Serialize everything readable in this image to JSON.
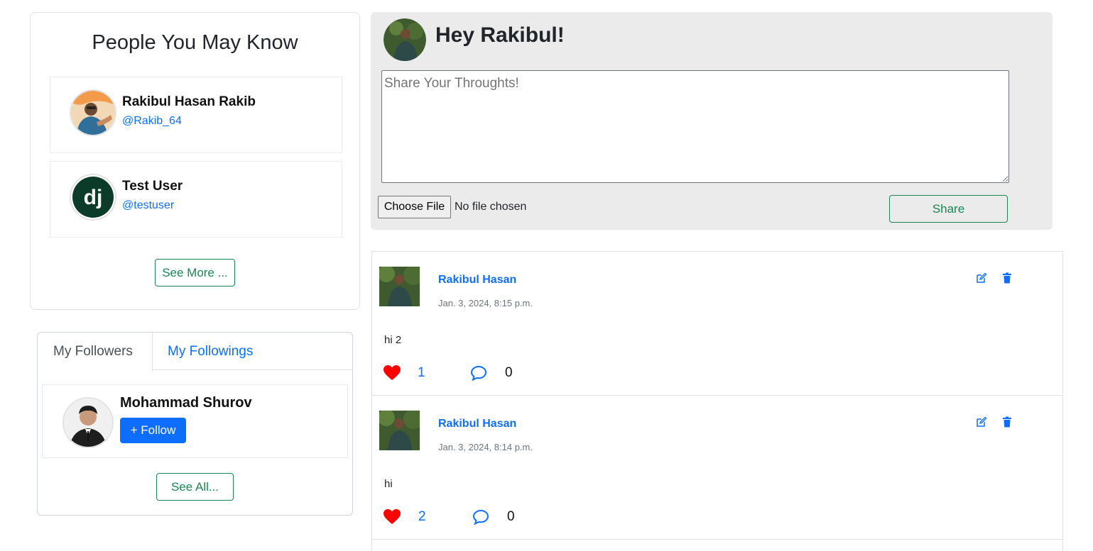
{
  "people_you_may_know": {
    "title": "People You May Know",
    "people": [
      {
        "name": "Rakibul Hasan Rakib",
        "handle": "@Rakib_64"
      },
      {
        "name": "Test User",
        "handle": "@testuser",
        "avatar_text": "dj"
      }
    ],
    "see_more_label": "See More ..."
  },
  "follow_panel": {
    "tabs": [
      {
        "label": "My Followers",
        "active": true
      },
      {
        "label": "My Followings",
        "active": false
      }
    ],
    "followers": [
      {
        "name": "Mohammad Shurov",
        "follow_label": "+ Follow"
      }
    ],
    "see_all_label": "See All..."
  },
  "composer": {
    "greeting": "Hey Rakibul!",
    "placeholder": "Share Your Throughts!",
    "file_button_label": "Choose File",
    "file_status": "No file chosen",
    "share_label": "Share"
  },
  "posts": [
    {
      "author": "Rakibul Hasan",
      "date": "Jan. 3, 2024, 8:15 p.m.",
      "body": "hi 2",
      "likes": "1",
      "comments": "0"
    },
    {
      "author": "Rakibul Hasan",
      "date": "Jan. 3, 2024, 8:14 p.m.",
      "body": "hi",
      "likes": "2",
      "comments": "0"
    }
  ],
  "colors": {
    "primary": "#0d6efd",
    "success": "#198754",
    "like": "#ff0000",
    "composer_bg": "#ebebeb"
  }
}
